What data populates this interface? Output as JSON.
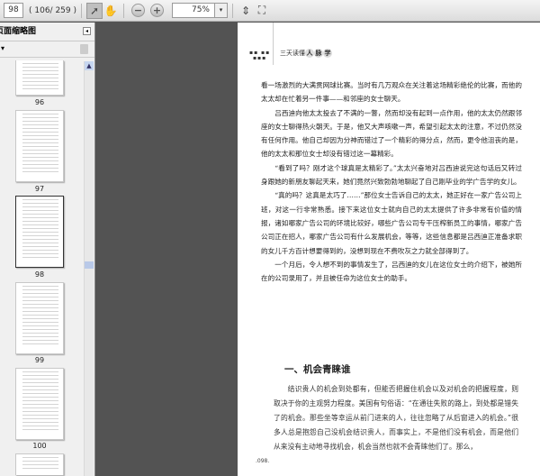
{
  "toolbar": {
    "page_input": "98",
    "page_count": "( 106/ 259 )",
    "zoom": "75%",
    "zoom_dropdown": "▾"
  },
  "panel": {
    "title": "页面缩略图",
    "close": "◂",
    "options": "▾"
  },
  "thumbnails": [
    {
      "label": "96"
    },
    {
      "label": "97"
    },
    {
      "label": "98"
    },
    {
      "label": "99"
    },
    {
      "label": "100"
    },
    {
      "label": ""
    }
  ],
  "page": {
    "running_head_dots": "▪▪ ▪▪\n▪▪▪",
    "running_head": "三天读懂",
    "running_head_badges": [
      "人",
      "脉",
      "学"
    ],
    "paragraphs": [
      {
        "indent": false,
        "text": "看一场激烈的大满贯网球比赛。当时有几万观众在关注着这场精彩绝伦的比赛，而他的太太却在忙着另一件事——和邻座的女士聊天。"
      },
      {
        "indent": true,
        "text": "吕西迪向他太太投去了不满的一瞥，然而却没有起到一点作用，他的太太仍然跟邻座的女士聊得热火朝天。于是，他又大声咳嗽一声，希望引起太太的注意，不过仍然没有任何作用。他自己却因为分神而错过了一个精彩的得分点，然而，更令他沮丧的是，他的太太和那位女士却没有错过这一幕精彩。"
      },
      {
        "indent": true,
        "text": "“看到了吗？刚才这个球真是太精彩了。”太太兴奋地对吕西迪说完这句话后又转过身跟她的新朋友聊起天来，她们竟然兴致勃勃地聊起了自己刚毕业的学广告学的女儿。"
      },
      {
        "indent": true,
        "text": "“真的吗？这真是太巧了……”那位女士告诉自己的太太，她正好在一家广告公司上班，对这一行非常熟悉。接下来这位女士就向自己的太太提供了许多非常有价值的情报，诸如哪家广告公司的环境比较好，哪些广告公司专干压榨新员工的事情，哪家广告公司正在招人，哪家广告公司有什么发展机会，等等，这些信息都是吕西迪正准备求职的女儿千方百计想要得到的，没想到现在不费吹灰之力就全部得到了。"
      },
      {
        "indent": true,
        "text": "一个月后，令人想不到的事情发生了，吕西迪的女儿在这位女士的介绍下，被她所在的公司录用了，并且被任命为这位女士的助手。"
      }
    ],
    "section_heading": "一、机会青睐谁",
    "section_body": "结识贵人的机会到处都有，但能否把握住机会以及对机会的把握程度，则取决于你的主观努力程度。美国有句俗语：“在通往失败的路上，到处都是错失了的机会。那些坐等幸运从前门进来的人，往往忽略了从后窗进入的机会。”很多人总是抱怨自己没机会结识贵人，而事实上，不是他们没有机会，而是他们从来没有主动地寻找机会，机会当然也就不会青睐他们了。那么，",
    "page_number": ".098."
  }
}
